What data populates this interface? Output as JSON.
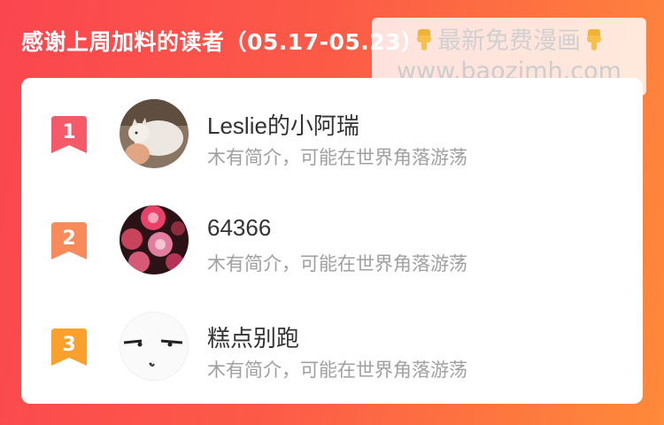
{
  "header": {
    "title": "感谢上周加料的读者（05.17-05.23）"
  },
  "watermark": {
    "line1": "最新免费漫画",
    "line2": "www.baozimh.com",
    "hand_icon": "pointing-down-hand-icon"
  },
  "readers": [
    {
      "rank": "1",
      "name": "Leslie的小阿瑞",
      "intro": "木有简介，可能在世界角落游荡",
      "rank_color": "#f45a68",
      "avatar": "white-cat-photo"
    },
    {
      "rank": "2",
      "name": "64366",
      "intro": "木有简介，可能在世界角落游荡",
      "rank_color": "#f98a5a",
      "avatar": "red-flowers-photo"
    },
    {
      "rank": "3",
      "name": "糕点别跑",
      "intro": "木有简介，可能在世界角落游荡",
      "rank_color": "#f9a12c",
      "avatar": "doodle-face-drawing"
    }
  ]
}
